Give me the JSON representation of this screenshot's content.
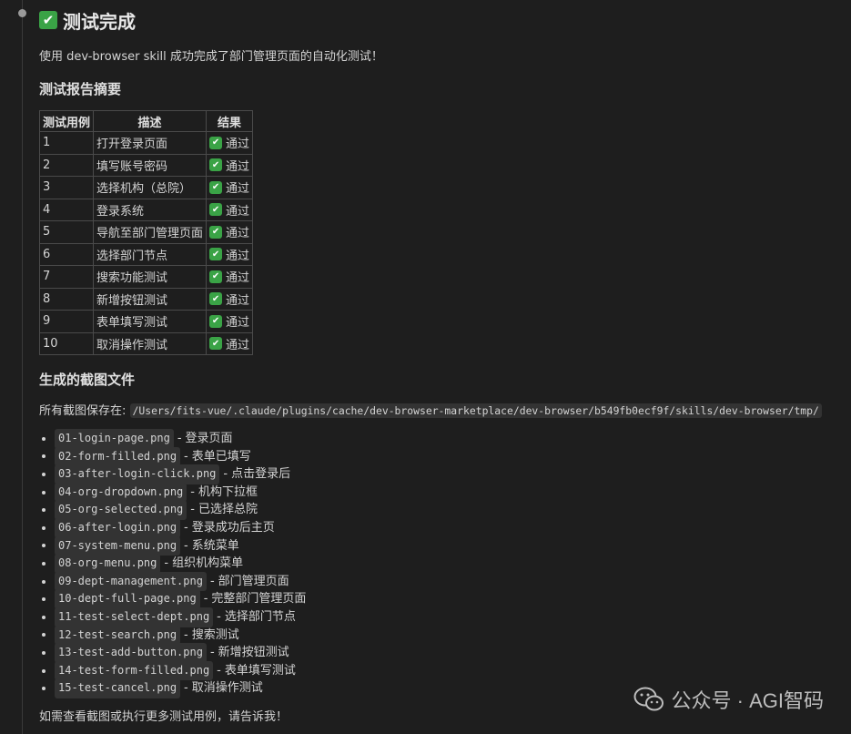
{
  "title": "测试完成",
  "intro": "使用 dev-browser skill 成功完成了部门管理页面的自动化测试！",
  "summary": {
    "heading": "测试报告摘要",
    "columns": [
      "测试用例",
      "描述",
      "结果"
    ],
    "rows": [
      {
        "id": "1",
        "desc": "打开登录页面",
        "result": "通过"
      },
      {
        "id": "2",
        "desc": "填写账号密码",
        "result": "通过"
      },
      {
        "id": "3",
        "desc": "选择机构（总院）",
        "result": "通过"
      },
      {
        "id": "4",
        "desc": "登录系统",
        "result": "通过"
      },
      {
        "id": "5",
        "desc": "导航至部门管理页面",
        "result": "通过"
      },
      {
        "id": "6",
        "desc": "选择部门节点",
        "result": "通过"
      },
      {
        "id": "7",
        "desc": "搜索功能测试",
        "result": "通过"
      },
      {
        "id": "8",
        "desc": "新增按钮测试",
        "result": "通过"
      },
      {
        "id": "9",
        "desc": "表单填写测试",
        "result": "通过"
      },
      {
        "id": "10",
        "desc": "取消操作测试",
        "result": "通过"
      }
    ]
  },
  "files": {
    "heading": "生成的截图文件",
    "path_label": "所有截图保存在:",
    "path": "/Users/fits-vue/.claude/plugins/cache/dev-browser-marketplace/dev-browser/b549fb0ecf9f/skills/dev-browser/tmp/",
    "items": [
      {
        "file": "01-login-page.png",
        "desc": "登录页面"
      },
      {
        "file": "02-form-filled.png",
        "desc": "表单已填写"
      },
      {
        "file": "03-after-login-click.png",
        "desc": "点击登录后"
      },
      {
        "file": "04-org-dropdown.png",
        "desc": "机构下拉框"
      },
      {
        "file": "05-org-selected.png",
        "desc": "已选择总院"
      },
      {
        "file": "06-after-login.png",
        "desc": "登录成功后主页"
      },
      {
        "file": "07-system-menu.png",
        "desc": "系统菜单"
      },
      {
        "file": "08-org-menu.png",
        "desc": "组织机构菜单"
      },
      {
        "file": "09-dept-management.png",
        "desc": "部门管理页面"
      },
      {
        "file": "10-dept-full-page.png",
        "desc": "完整部门管理页面"
      },
      {
        "file": "11-test-select-dept.png",
        "desc": "选择部门节点"
      },
      {
        "file": "12-test-search.png",
        "desc": "搜索测试"
      },
      {
        "file": "13-test-add-button.png",
        "desc": "新增按钮测试"
      },
      {
        "file": "14-test-form-filled.png",
        "desc": "表单填写测试"
      },
      {
        "file": "15-test-cancel.png",
        "desc": "取消操作测试"
      }
    ]
  },
  "closing": "如需查看截图或执行更多测试用例，请告诉我！",
  "watermark": "公众号 · AGI智码",
  "icons": {
    "check": "check-mark-icon",
    "watermark": "wechat-icon"
  },
  "colors": {
    "background": "#1e1e1e",
    "check_green": "#3aa346",
    "code_bg": "#333333"
  }
}
